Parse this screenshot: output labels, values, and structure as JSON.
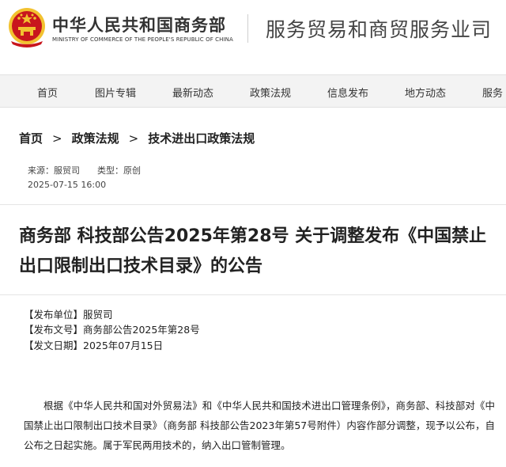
{
  "header": {
    "ministry_cn": "中华人民共和国商务部",
    "ministry_en": "MINISTRY OF COMMERCE OF THE PEOPLE'S REPUBLIC OF CHINA",
    "site_name": "服务贸易和商贸服务业司",
    "emblem_icon": "national-emblem-icon"
  },
  "nav": {
    "items": [
      "首页",
      "图片专辑",
      "最新动态",
      "政策法规",
      "信息发布",
      "地方动态",
      "服务"
    ]
  },
  "breadcrumb": {
    "items": [
      "首页",
      "政策法规",
      "技术进出口政策法规"
    ],
    "separator": ">"
  },
  "meta": {
    "source": "来源：服贸司",
    "type": "类型：原创",
    "datetime": "2025-07-15 16:00"
  },
  "article": {
    "title": "商务部 科技部公告2025年第28号 关于调整发布《中国禁止出口限制出口技术目录》的公告",
    "info": [
      "【发布单位】服贸司",
      "【发布文号】商务部公告2025年第28号",
      "【发文日期】2025年07月15日"
    ],
    "paragraph": "根据《中华人民共和国对外贸易法》和《中华人民共和国技术进出口管理条例》，商务部、科技部对《中国禁止出口限制出口技术目录》（商务部 科技部公告2023年第57号附件）内容作部分调整，现予以公布，自公布之日起实施。属于军民两用技术的，纳入出口管制管理。"
  },
  "colors": {
    "emblem_red": "#c8161d",
    "emblem_gold": "#f2c230",
    "nav_bg": "#f3f3f3"
  }
}
